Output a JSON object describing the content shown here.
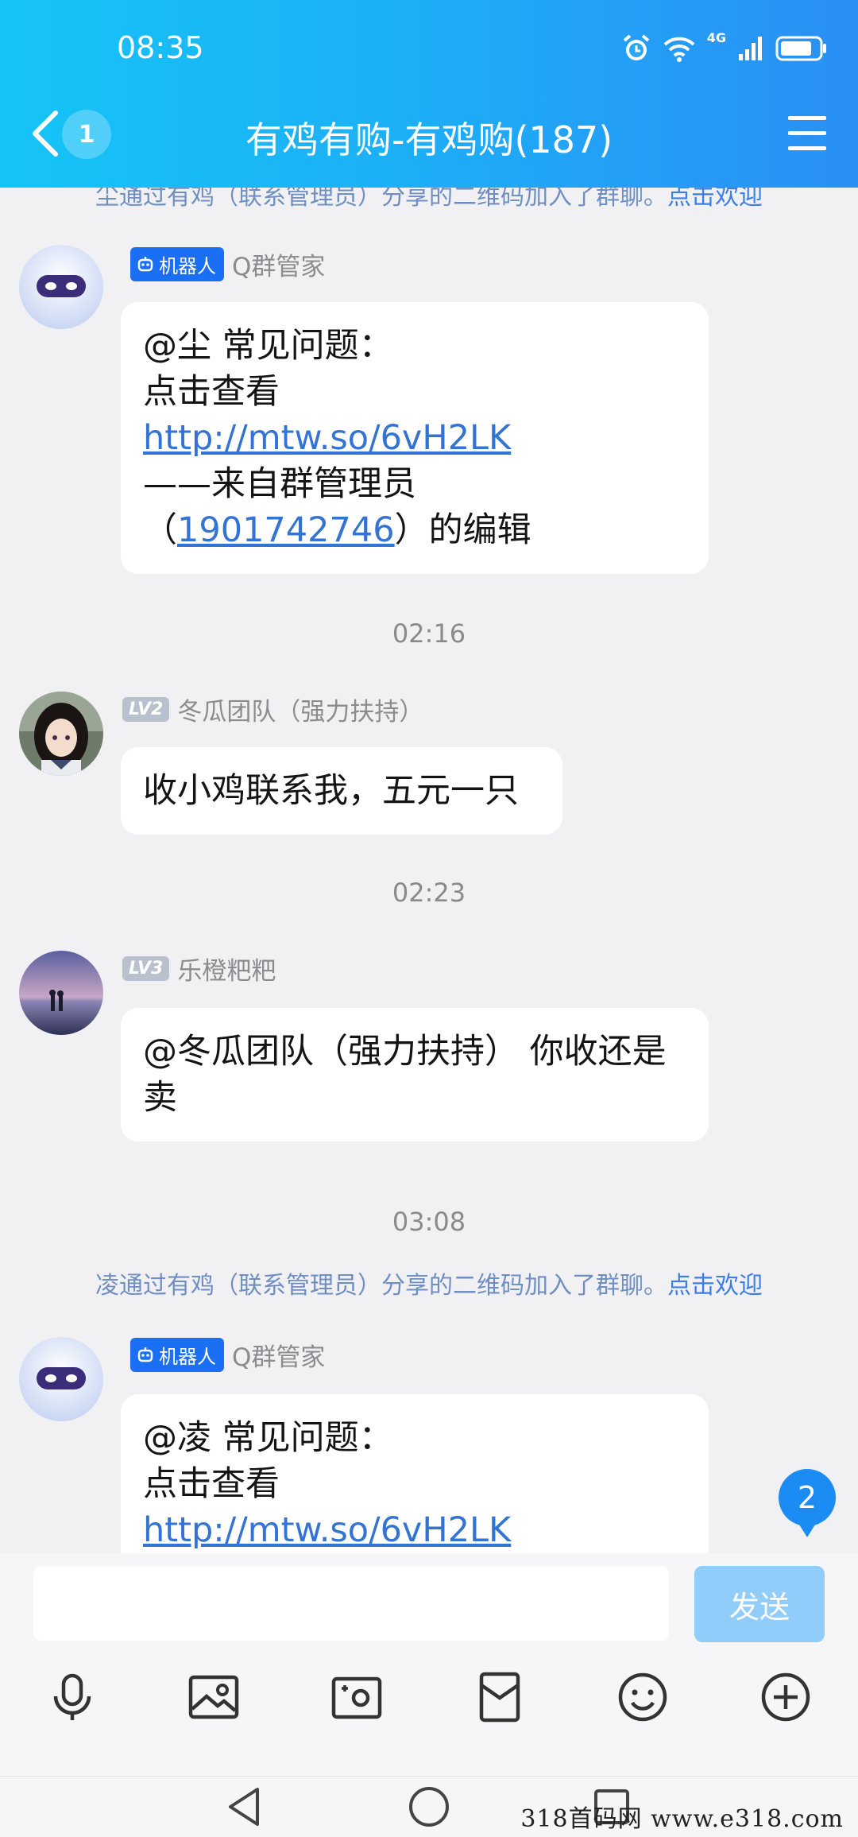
{
  "status_bar": {
    "time": "08:35",
    "network": "4G"
  },
  "header": {
    "unread_count": "1",
    "title": "有鸡有购-有鸡购(187)"
  },
  "chat": {
    "top_system_message": {
      "text": "尘通过有鸡（联系管理员）分享的二维码加入了群聊。",
      "action": "点击欢迎"
    },
    "messages": [
      {
        "badge": "机器人",
        "sender": "Q群管家",
        "lines": [
          "@尘 常见问题：",
          "点击查看"
        ],
        "link": "http://mtw.so/6vH2LK",
        "line_after": "——来自群管理员",
        "editor_prefix": "（",
        "editor_id": "1901742746",
        "editor_suffix": "）的编辑"
      },
      {
        "timestamp": "02:16",
        "level": "LV2",
        "sender": "冬瓜团队（强力扶持）",
        "text": "收小鸡联系我，五元一只"
      },
      {
        "timestamp": "02:23",
        "level": "LV3",
        "sender": "乐橙粑粑",
        "text": "@冬瓜团队（强力扶持） 你收还是卖"
      },
      {
        "timestamp": "03:08"
      }
    ],
    "system_message_2": {
      "text": "凌通过有鸡（联系管理员）分享的二维码加入了群聊。",
      "action": "点击欢迎"
    },
    "last_message": {
      "badge": "机器人",
      "sender": "Q群管家",
      "lines": [
        "@凌 常见问题：",
        "点击查看"
      ],
      "link": "http://mtw.so/6vH2LK"
    },
    "new_message_count": "2"
  },
  "input": {
    "value": "",
    "send_label": "发送"
  },
  "toolbar": {
    "icons": [
      "microphone-icon",
      "image-icon",
      "camera-icon",
      "red-packet-icon",
      "emoji-icon",
      "plus-icon"
    ]
  },
  "watermark": "318首码网  www.e318.com",
  "colors": {
    "header_start": "#15c4f7",
    "header_end": "#2a8ff5",
    "bot_badge": "#1b6ff5",
    "link": "#3373d4",
    "send_disabled": "#90cdfb"
  }
}
